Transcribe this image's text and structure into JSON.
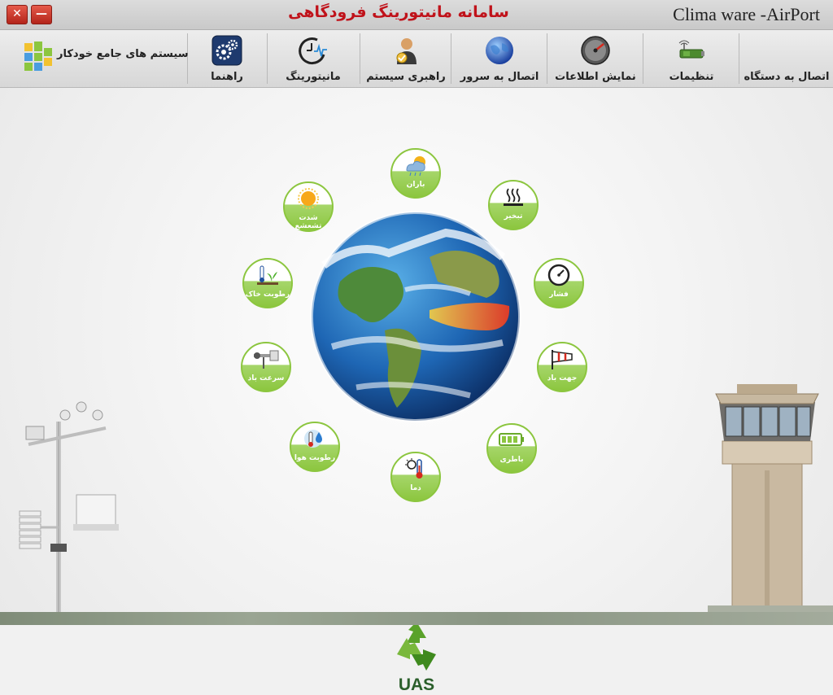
{
  "window": {
    "title_center": "سامانه  مانیتورینگ فرودگاهی",
    "title_right": "Clima ware -AirPort",
    "close_label": "✕",
    "minimize_label": "—"
  },
  "toolbar": {
    "items": [
      {
        "label": "اتصال به دستگاه",
        "icon": "device-connect-icon"
      },
      {
        "label": "تنظیمات",
        "icon": "settings-device-icon"
      },
      {
        "label": "نمایش اطلاعات",
        "icon": "gauge-icon"
      },
      {
        "label": "اتصال به سرور",
        "icon": "globe-server-icon"
      },
      {
        "label": "راهبری سیستم",
        "icon": "admin-user-icon"
      },
      {
        "label": "مانیتورینگ",
        "icon": "monitoring-clock-icon"
      },
      {
        "label": "راهنما",
        "icon": "help-gears-icon"
      }
    ],
    "brand": "سیستم های جامع  خودکار"
  },
  "sensors": [
    {
      "label": "باران",
      "icon": "rain-cloud-icon"
    },
    {
      "label": "تبخیر",
      "icon": "evaporation-icon"
    },
    {
      "label": "فشار",
      "icon": "pressure-gauge-icon"
    },
    {
      "label": "جهت باد",
      "icon": "windsock-icon"
    },
    {
      "label": "باطری",
      "icon": "battery-icon"
    },
    {
      "label": "دما",
      "icon": "thermometer-sun-icon"
    },
    {
      "label": "رطوبت هوا",
      "icon": "humidity-icon"
    },
    {
      "label": "سرعت باد",
      "icon": "anemometer-icon"
    },
    {
      "label": "رطوبت خاک",
      "icon": "soil-moisture-icon"
    },
    {
      "label": "شدت تشعشع",
      "icon": "sun-radiation-icon"
    }
  ],
  "logo": {
    "label": "UAS"
  },
  "colors": {
    "title_red": "#c0121a",
    "sensor_green": "#8cc63f",
    "logo_green": "#2b5f2b"
  }
}
